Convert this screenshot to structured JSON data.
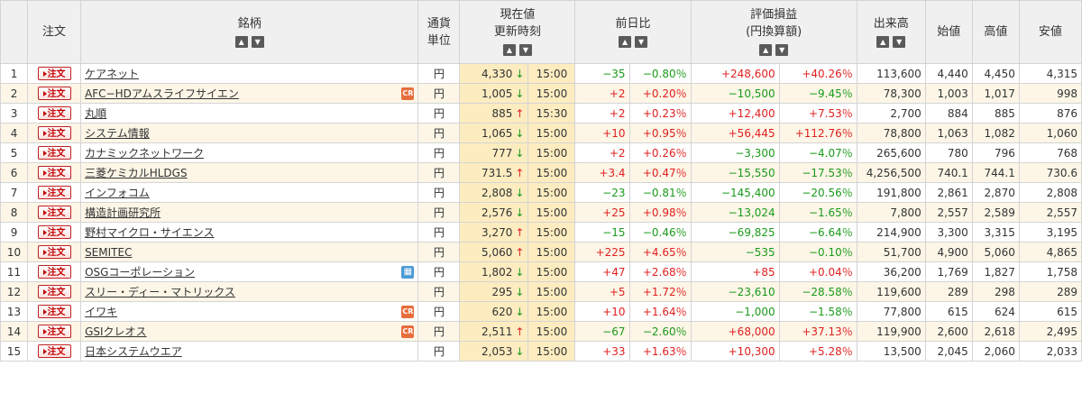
{
  "headers": {
    "order": "注文",
    "name": "銘柄",
    "currency": [
      "通貨",
      "単位"
    ],
    "price": [
      "現在値",
      "更新時刻"
    ],
    "change": "前日比",
    "pl": [
      "評価損益",
      "(円換算額)"
    ],
    "volume": "出来高",
    "open": "始値",
    "high": "高値",
    "low": "安値"
  },
  "sort_up": "▲",
  "sort_down": "▼",
  "order_label": "注文",
  "rows": [
    {
      "no": "1",
      "name": "ケアネット",
      "badge": "",
      "currency": "円",
      "price": "4,330",
      "dir": "down",
      "time": "15:00",
      "chg": "−35",
      "chgp": "−0.80％",
      "chg_dir": "down",
      "pl": "+248,600",
      "plp": "+40.26％",
      "pl_dir": "up",
      "volume": "113,600",
      "open": "4,440",
      "high": "4,450",
      "low": "4,315"
    },
    {
      "no": "2",
      "name": "AFC−HDアムスライフサイエン",
      "badge": "cr",
      "currency": "円",
      "price": "1,005",
      "dir": "down",
      "time": "15:00",
      "chg": "+2",
      "chgp": "+0.20％",
      "chg_dir": "up",
      "pl": "−10,500",
      "plp": "−9.45％",
      "pl_dir": "down",
      "volume": "78,300",
      "open": "1,003",
      "high": "1,017",
      "low": "998"
    },
    {
      "no": "3",
      "name": "丸順",
      "badge": "",
      "currency": "円",
      "price": "885",
      "dir": "up",
      "time": "15:30",
      "chg": "+2",
      "chgp": "+0.23％",
      "chg_dir": "up",
      "pl": "+12,400",
      "plp": "+7.53％",
      "pl_dir": "up",
      "volume": "2,700",
      "open": "884",
      "high": "885",
      "low": "876"
    },
    {
      "no": "4",
      "name": "システム情報",
      "badge": "",
      "currency": "円",
      "price": "1,065",
      "dir": "down",
      "time": "15:00",
      "chg": "+10",
      "chgp": "+0.95％",
      "chg_dir": "up",
      "pl": "+56,445",
      "plp": "+112.76％",
      "pl_dir": "up",
      "volume": "78,800",
      "open": "1,063",
      "high": "1,082",
      "low": "1,060"
    },
    {
      "no": "5",
      "name": "カナミックネットワーク",
      "badge": "",
      "currency": "円",
      "price": "777",
      "dir": "down",
      "time": "15:00",
      "chg": "+2",
      "chgp": "+0.26％",
      "chg_dir": "up",
      "pl": "−3,300",
      "plp": "−4.07％",
      "pl_dir": "down",
      "volume": "265,600",
      "open": "780",
      "high": "796",
      "low": "768"
    },
    {
      "no": "6",
      "name": "三菱ケミカルHLDGS",
      "badge": "",
      "currency": "円",
      "price": "731.5",
      "dir": "up",
      "time": "15:00",
      "chg": "+3.4",
      "chgp": "+0.47％",
      "chg_dir": "up",
      "pl": "−15,550",
      "plp": "−17.53％",
      "pl_dir": "down",
      "volume": "4,256,500",
      "open": "740.1",
      "high": "744.1",
      "low": "730.6"
    },
    {
      "no": "7",
      "name": "インフォコム",
      "badge": "",
      "currency": "円",
      "price": "2,808",
      "dir": "down",
      "time": "15:00",
      "chg": "−23",
      "chgp": "−0.81％",
      "chg_dir": "down",
      "pl": "−145,400",
      "plp": "−20.56％",
      "pl_dir": "down",
      "volume": "191,800",
      "open": "2,861",
      "high": "2,870",
      "low": "2,808"
    },
    {
      "no": "8",
      "name": "構造計画研究所",
      "badge": "",
      "currency": "円",
      "price": "2,576",
      "dir": "down",
      "time": "15:00",
      "chg": "+25",
      "chgp": "+0.98％",
      "chg_dir": "up",
      "pl": "−13,024",
      "plp": "−1.65％",
      "pl_dir": "down",
      "volume": "7,800",
      "open": "2,557",
      "high": "2,589",
      "low": "2,557"
    },
    {
      "no": "9",
      "name": "野村マイクロ・サイエンス",
      "badge": "",
      "currency": "円",
      "price": "3,270",
      "dir": "up",
      "time": "15:00",
      "chg": "−15",
      "chgp": "−0.46％",
      "chg_dir": "down",
      "pl": "−69,825",
      "plp": "−6.64％",
      "pl_dir": "down",
      "volume": "214,900",
      "open": "3,300",
      "high": "3,315",
      "low": "3,195"
    },
    {
      "no": "10",
      "name": "SEMITEC",
      "badge": "",
      "currency": "円",
      "price": "5,060",
      "dir": "up",
      "time": "15:00",
      "chg": "+225",
      "chgp": "+4.65％",
      "chg_dir": "up",
      "pl": "−535",
      "plp": "−0.10％",
      "pl_dir": "down",
      "volume": "51,700",
      "open": "4,900",
      "high": "5,060",
      "low": "4,865"
    },
    {
      "no": "11",
      "name": "OSGコーポレーション",
      "badge": "cal",
      "currency": "円",
      "price": "1,802",
      "dir": "down",
      "time": "15:00",
      "chg": "+47",
      "chgp": "+2.68％",
      "chg_dir": "up",
      "pl": "+85",
      "plp": "+0.04％",
      "pl_dir": "up",
      "volume": "36,200",
      "open": "1,769",
      "high": "1,827",
      "low": "1,758"
    },
    {
      "no": "12",
      "name": "スリー・ディー・マトリックス",
      "badge": "",
      "currency": "円",
      "price": "295",
      "dir": "down",
      "time": "15:00",
      "chg": "+5",
      "chgp": "+1.72％",
      "chg_dir": "up",
      "pl": "−23,610",
      "plp": "−28.58％",
      "pl_dir": "down",
      "volume": "119,600",
      "open": "289",
      "high": "298",
      "low": "289"
    },
    {
      "no": "13",
      "name": "イワキ",
      "badge": "cr",
      "currency": "円",
      "price": "620",
      "dir": "down",
      "time": "15:00",
      "chg": "+10",
      "chgp": "+1.64％",
      "chg_dir": "up",
      "pl": "−1,000",
      "plp": "−1.58％",
      "pl_dir": "down",
      "volume": "77,800",
      "open": "615",
      "high": "624",
      "low": "615"
    },
    {
      "no": "14",
      "name": "GSIクレオス",
      "badge": "cr",
      "currency": "円",
      "price": "2,511",
      "dir": "up",
      "time": "15:00",
      "chg": "−67",
      "chgp": "−2.60％",
      "chg_dir": "down",
      "pl": "+68,000",
      "plp": "+37.13％",
      "pl_dir": "up",
      "volume": "119,900",
      "open": "2,600",
      "high": "2,618",
      "low": "2,495"
    },
    {
      "no": "15",
      "name": "日本システムウエア",
      "badge": "",
      "currency": "円",
      "price": "2,053",
      "dir": "down",
      "time": "15:00",
      "chg": "+33",
      "chgp": "+1.63％",
      "chg_dir": "up",
      "pl": "+10,300",
      "plp": "+5.28％",
      "pl_dir": "up",
      "volume": "13,500",
      "open": "2,045",
      "high": "2,060",
      "low": "2,033"
    }
  ],
  "colors": {
    "up": "#e02020",
    "down": "#1a9a1a",
    "price_bg": "#fcecc0",
    "row_even_bg": "#fdf6e7",
    "header_bg": "#f0f0f0"
  },
  "icons": {
    "badge_cr": "credit-badge-icon",
    "badge_cal": "calendar-icon",
    "arrow_up": "arrow-up-icon",
    "arrow_down": "arrow-down-icon"
  }
}
